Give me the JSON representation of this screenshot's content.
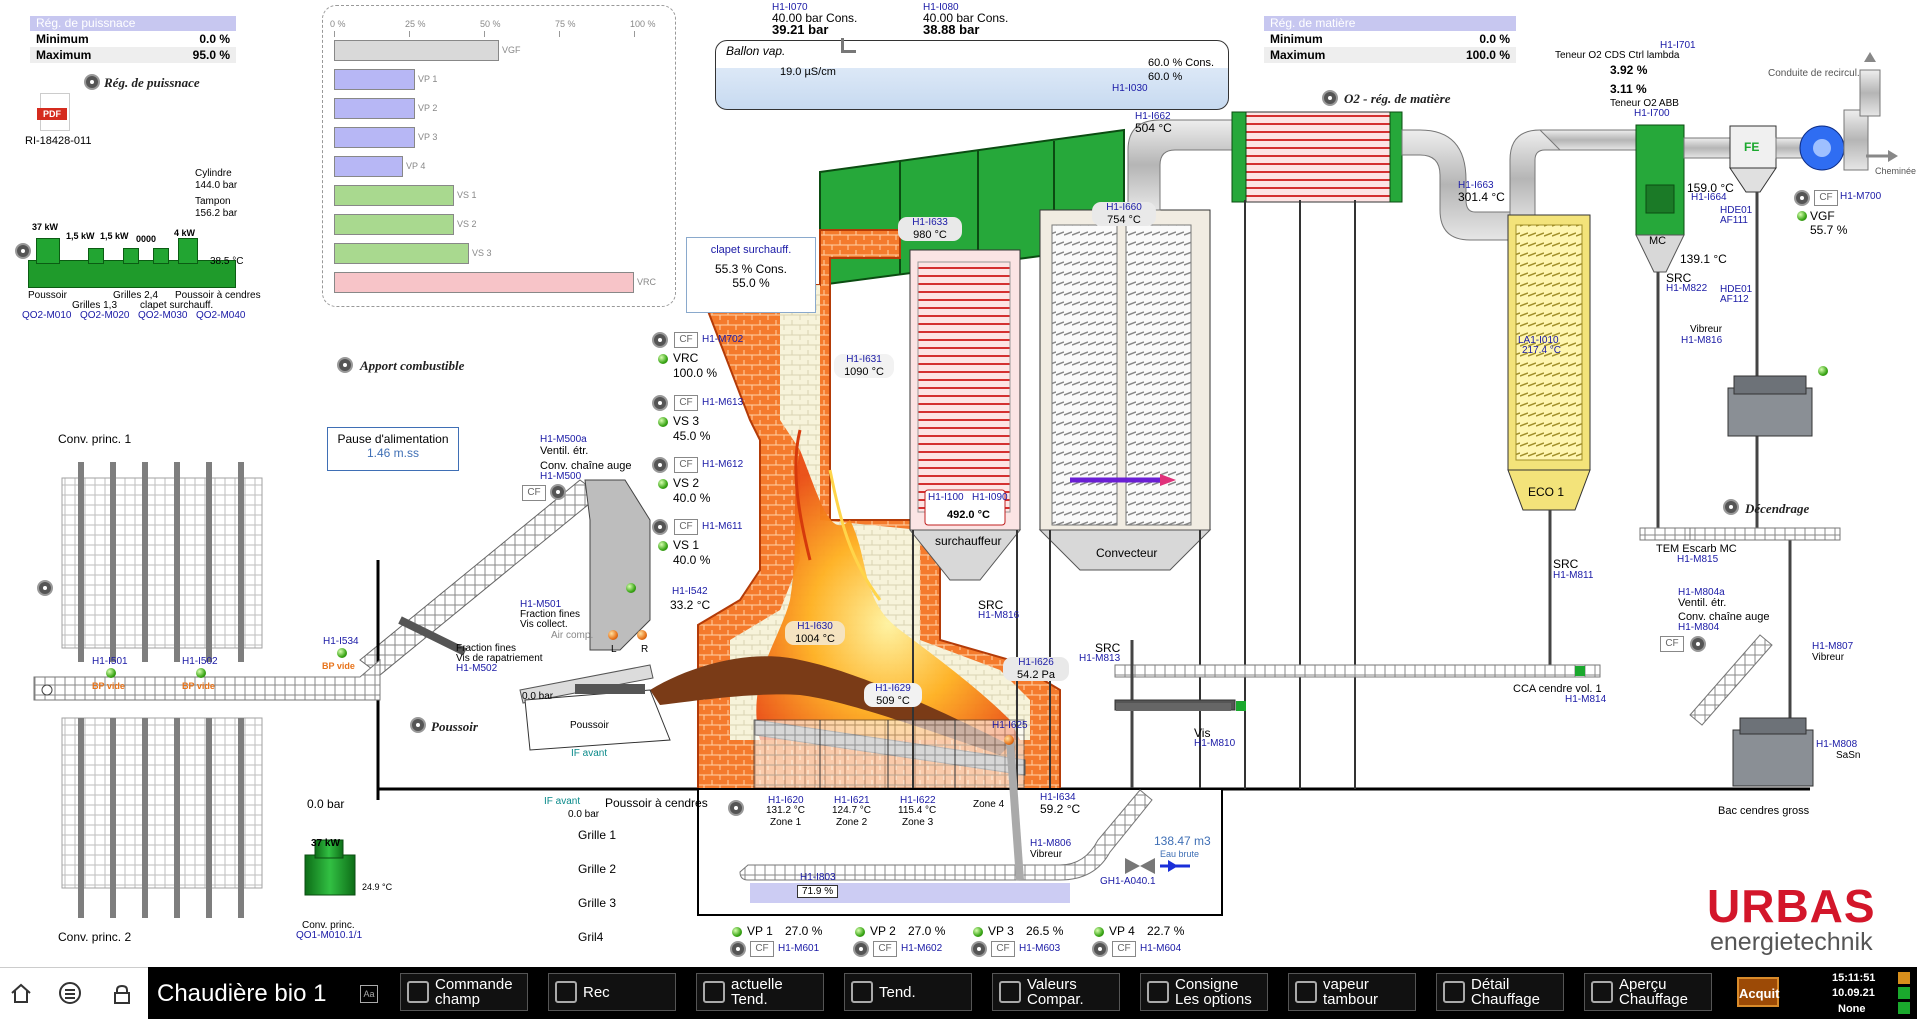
{
  "power_reg": {
    "title": "Rég. de puissnace",
    "min_label": "Minimum",
    "min_value": "0.0 %",
    "max_label": "Maximum",
    "max_value": "95.0 %",
    "button": "Rég. de puissnace"
  },
  "pdf": {
    "label": "RI-18428-011",
    "badge": "PDF"
  },
  "pressures": {
    "cyl_label": "Cylindre",
    "cyl_value": "144.0 bar",
    "tampon_label": "Tampon",
    "tampon_value": "156.2 bar"
  },
  "hydraulic": {
    "kw": [
      "37 kW",
      "1,5 kW",
      "1,5 kW",
      "0000",
      "4 kW"
    ],
    "temp": "38.5 °C",
    "labels": [
      "Poussoir",
      "Grilles 2,4",
      "Poussoir à cendres",
      "Grilles 1,3",
      "clapet surchauff."
    ],
    "tags": [
      "QO2-M010",
      "QO2-M020",
      "QO2-M030",
      "QO2-M040"
    ]
  },
  "fan_chart": {
    "ticks": [
      "0 %",
      "25 %",
      "50 %",
      "75 %",
      "100 %"
    ],
    "bars": [
      {
        "name": "VGF",
        "value": 55,
        "color": "#d9d9d9"
      },
      {
        "name": "VP 1",
        "value": 27,
        "color": "#b7b7f5"
      },
      {
        "name": "VP 2",
        "value": 27,
        "color": "#b7b7f5"
      },
      {
        "name": "VP 3",
        "value": 27,
        "color": "#b7b7f5"
      },
      {
        "name": "VP 4",
        "value": 23,
        "color": "#b7b7f5"
      },
      {
        "name": "VS 1",
        "value": 40,
        "color": "#a9d98f"
      },
      {
        "name": "VS 2",
        "value": 40,
        "color": "#a9d98f"
      },
      {
        "name": "VS 3",
        "value": 45,
        "color": "#a9d98f"
      },
      {
        "name": "VRC",
        "value": 100,
        "color": "#f7c4c8"
      }
    ]
  },
  "apport": "Apport combustible",
  "drum": {
    "i070": "H1-I070",
    "i070_val": "40.00 bar Cons.",
    "i070_val2": "39.21 bar",
    "i080": "H1-I080",
    "i080_val": "40.00 bar Cons.",
    "i080_val2": "38.88 bar",
    "title": "Ballon vap.",
    "cond": "19.0 µS/cm",
    "cons": "60.0 % Cons.",
    "level": "60.0 %",
    "tag": "H1-I030"
  },
  "matter_reg": {
    "title": "Rég. de matière",
    "min_label": "Minimum",
    "min_value": "0.0 %",
    "max_label": "Maximum",
    "max_value": "100.0 %",
    "button": "O2 - rég. de matière"
  },
  "o2": {
    "ctrl_label": "Teneur O2 CDS Ctrl lambda",
    "ctrl_value": "3.92 %",
    "ctrl_tag": "H1-I701",
    "abb_value": "3.11 %",
    "abb_label": "Teneur O2 ABB",
    "abb_tag": "H1-I700"
  },
  "flue": {
    "recirc": "Conduite de recircul.",
    "chimney": "Cheminée",
    "fe": "FE"
  },
  "sensors": {
    "i662": "H1-I662",
    "i662_val": "504 °C",
    "i663": "H1-I663",
    "i663_val": "301.4 °C",
    "i664": "H1-I664",
    "i664_val": "159.0 °C",
    "i633": "H1-I633",
    "i633_val": "980 °C",
    "i660": "H1-I660",
    "i660_val": "754 °C",
    "i631": "H1-I631",
    "i631_val": "1090 °C",
    "i630": "H1-I630",
    "i630_val": "1004 °C",
    "i629": "H1-I629",
    "i629_val": "509 °C",
    "i626": "H1-I626",
    "i626_val": "54.2 Pa",
    "i625": "H1-I625",
    "i634": "H1-I634",
    "i634_val": "59.2 °C",
    "i542": "H1-I542",
    "i542_val": "33.2 °C",
    "i100": "H1-I100",
    "i090": "H1-I090",
    "sh_val": "492.0 °C",
    "mc_temp": "139.1 °C",
    "i010": "LA1-I010",
    "i010_val": "217.4 °C"
  },
  "m700": {
    "tag": "H1-M700",
    "name": "VGF",
    "value": "55.7 %"
  },
  "hde": {
    "a": "HDE01",
    "a2": "AF111",
    "b": "HDE01",
    "b2": "AF112"
  },
  "clapet": {
    "title": "clapet surchauff.",
    "cons": "55.3 % Cons.",
    "value": "55.0 %"
  },
  "sec_fans": [
    {
      "tag": "H1-M702",
      "name": "VRC",
      "value": "100.0 %"
    },
    {
      "tag": "H1-M613",
      "name": "VS 3",
      "value": "45.0 %"
    },
    {
      "tag": "H1-M612",
      "name": "VS 2",
      "value": "40.0 %"
    },
    {
      "tag": "H1-M611",
      "name": "VS 1",
      "value": "40.0 %"
    }
  ],
  "prim_fans": [
    {
      "name": "VP 1",
      "value": "27.0 %",
      "tag": "H1-M601"
    },
    {
      "name": "VP 2",
      "value": "27.0 %",
      "tag": "H1-M602"
    },
    {
      "name": "VP 3",
      "value": "26.5 %",
      "tag": "H1-M603"
    },
    {
      "name": "VP 4",
      "value": "22.7 %",
      "tag": "H1-M604"
    }
  ],
  "zones": [
    {
      "tag": "H1-I620",
      "val": "131.2 °C",
      "name": "Zone 1"
    },
    {
      "tag": "H1-I621",
      "val": "124.7 °C",
      "name": "Zone 2"
    },
    {
      "tag": "H1-I622",
      "val": "115.4 °C",
      "name": "Zone 3"
    },
    {
      "name": "Zone 4"
    }
  ],
  "feed": {
    "pause_title": "Pause d'alimentation",
    "pause_value": "1.46 m.ss",
    "m500a": "H1-M500a",
    "vent": "Ventil. étr.",
    "chain": "Conv. chaîne auge",
    "m500": "H1-M500",
    "m501": "H1-M501",
    "fines": "Fraction fines",
    "vis_collect": "Vis collect.",
    "air_comp": "Air comp.",
    "fines2": "Fraction fines",
    "vis_rap": "Vis de rapatriement",
    "m502": "H1-M502",
    "i534": "H1-I534",
    "bp_vide": "BP vide",
    "i501": "H1-I501",
    "i502": "H1-I502",
    "bp_vide2": "BP vide",
    "bp_vide3": "BP vide",
    "poussoir_btn": "Poussoir",
    "poussoir": "Poussoir",
    "bar1": "0.0 bar",
    "bar2": "0.0 bar",
    "bar3": "0.0 bar",
    "if_avant": "IF avant",
    "if_avant2": "IF avant",
    "pac": "Poussoir à cendres",
    "l": "L",
    "r": "R"
  },
  "conv": {
    "c1": "Conv. princ. 1",
    "c2": "Conv. princ. 2",
    "kw": "37 kW",
    "temp": "24.9 °C",
    "name": "Conv. princ.",
    "tag": "QO1-M010.1/1"
  },
  "grilles": [
    "Grille 1",
    "Grille 2",
    "Grille 3",
    "Gril4"
  ],
  "ash": {
    "i803": "H1-I803",
    "level": "71.9 %",
    "m806": "H1-M806",
    "vibreur": "Vibreur",
    "water": "138.47 m3",
    "water_label": "Eau brute",
    "valve": "GH1-A040.1",
    "src1": "SRC",
    "m816": "H1-M816",
    "src2": "SRC",
    "m813": "H1-M813",
    "vis": "Vis",
    "m810": "H1-M810",
    "src3": "SRC",
    "m811": "H1-M811",
    "cca": "CCA cendre vol. 1",
    "m814": "H1-M814",
    "src4": "SRC",
    "m822": "H1-M822"
  },
  "right": {
    "vibreur": "Vibreur",
    "m816": "H1-M816",
    "decendrage": "Décendrage",
    "tem": "TEM Escarb MC",
    "m815": "H1-M815",
    "m804a": "H1-M804a",
    "vent": "Ventil. étr.",
    "chain": "Conv. chaîne auge",
    "m804": "H1-M804",
    "m807": "H1-M807",
    "vibreur2": "Vibreur",
    "m808": "H1-M808",
    "sasn": "SaSn",
    "bac": "Bac cendres gross"
  },
  "units": {
    "surch": "surchauffeur",
    "conv": "Convecteur",
    "eco": "ECO 1",
    "mc": "MC"
  },
  "logo": {
    "brand": "URBAS",
    "sub": "energietechnik"
  },
  "footer": {
    "title": "Chaudière bio 1",
    "buttons": [
      {
        "l1": "Commande",
        "l2": "champ"
      },
      {
        "l1": "Rec",
        "l2": ""
      },
      {
        "l1": "actuelle",
        "l2": "Tend."
      },
      {
        "l1": "Tend.",
        "l2": ""
      },
      {
        "l1": "Valeurs",
        "l2": "Compar."
      },
      {
        "l1": "Consigne",
        "l2": "Les options"
      },
      {
        "l1": "vapeur",
        "l2": "tambour"
      },
      {
        "l1": "Détail",
        "l2": "Chauffage"
      },
      {
        "l1": "Aperçu",
        "l2": "Chauffage"
      }
    ],
    "ack": "Acquit",
    "time": "15:11:51",
    "date": "10.09.21",
    "user": "None"
  }
}
